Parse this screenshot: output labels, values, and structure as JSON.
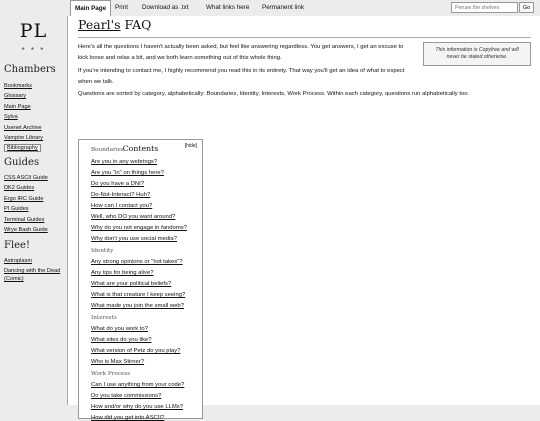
{
  "site": {
    "logo": "PL",
    "stars": "* * *"
  },
  "sidebar": {
    "sections": [
      {
        "heading": "Chambers",
        "items": [
          "Bookmarks",
          "Glossary",
          "Main Page",
          "Sylva",
          "Usenet Archive",
          "Vampire Library",
          "Bibliography"
        ]
      },
      {
        "heading": "Guides",
        "items": [
          "CSS ASCII Guide",
          "DK2 Guides",
          "Ergo IRC Guide",
          "PI Guides",
          "Terminal Guides",
          "Wrye Bash Guide"
        ]
      },
      {
        "heading": "Flee!",
        "items": [
          "Astroplasm",
          "Dancing with the Dead",
          "(Comic)"
        ]
      }
    ]
  },
  "topbar": {
    "tabs": [
      "Main Page",
      "Print",
      "Download as .txt",
      "What links here",
      "Permanent link"
    ],
    "search_placeholder": "Peruse the shelves",
    "search_button": "Go"
  },
  "page": {
    "title_link": "Pearl's",
    "title_rest": " FAQ",
    "notice": "This information is Copyfree and will never be stated otherwise.",
    "intro": [
      "Here's all the questions I haven't actually been asked, but feel like answering regardless. You get answers, I get an excuse to kick loose and relax a bit, and we both learn something out of this whole thing.",
      "If you're intending to contact me, I highly recommend you read this in its entirety. That way you'll get an idea of what to expect when we talk.",
      "Questions are sorted by category, alphabetically: Boundaries, Identity, Interests, Work Process. Within each category, questions run alphabetically too."
    ]
  },
  "toc": {
    "title": "Contents",
    "hide": "[hide]",
    "categories": [
      {
        "name": "Boundaries",
        "questions": [
          "Are you in any webrings?",
          "Are you \"in\" on things here?",
          "Do you have a DNI?",
          "Do-Not-Interact? Huh?",
          "How can I contact you?",
          "Well, who DO you want around?",
          "Why do you not engage in fandoms?",
          "Why don't you use social media?"
        ]
      },
      {
        "name": "Identity",
        "questions": [
          "Any strong opinions or \"hot takes\"?",
          "Any tips for being alive?",
          "What are your political beliefs?",
          "What is that creature I keep seeing?",
          "What made you join the small web?"
        ]
      },
      {
        "name": "Interests",
        "questions": [
          "What do you work to?",
          "What sites do you like?",
          "What version of Petz do you play?",
          "Who is Max Stirner?"
        ]
      },
      {
        "name": "Work Process",
        "questions": [
          "Can I use anything from your code?",
          "Do you take commissions?",
          "How and/or why do you use LLMs?",
          "How did you get into ASCII?"
        ]
      }
    ]
  }
}
